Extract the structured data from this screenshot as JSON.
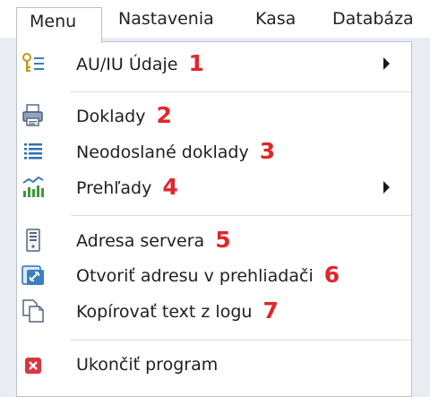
{
  "menubar": {
    "items": [
      "Menu",
      "Nastavenia",
      "Kasa",
      "Databáza"
    ]
  },
  "dropdown": {
    "items": [
      {
        "label": "AU/IU Údaje",
        "number": "1",
        "icon": "keys-icon",
        "submenu": true
      },
      {
        "label": "Doklady",
        "number": "2",
        "icon": "printer-icon",
        "submenu": false
      },
      {
        "label": "Neodoslané doklady",
        "number": "3",
        "icon": "list-icon",
        "submenu": false
      },
      {
        "label": "Prehľady",
        "number": "4",
        "icon": "chart-icon",
        "submenu": true
      },
      {
        "label": "Adresa servera",
        "number": "5",
        "icon": "server-icon",
        "submenu": false
      },
      {
        "label": "Otvoriť adresu v prehliadači",
        "number": "6",
        "icon": "link-icon",
        "submenu": false
      },
      {
        "label": "Kopírovať text z logu",
        "number": "7",
        "icon": "copy-icon",
        "submenu": false
      },
      {
        "label": "Ukončiť program",
        "number": "",
        "icon": "exit-icon",
        "submenu": false
      }
    ]
  },
  "colors": {
    "annotation": "#e2262a",
    "icon_blue": "#2f6fb6",
    "exit_red": "#d9363e"
  }
}
